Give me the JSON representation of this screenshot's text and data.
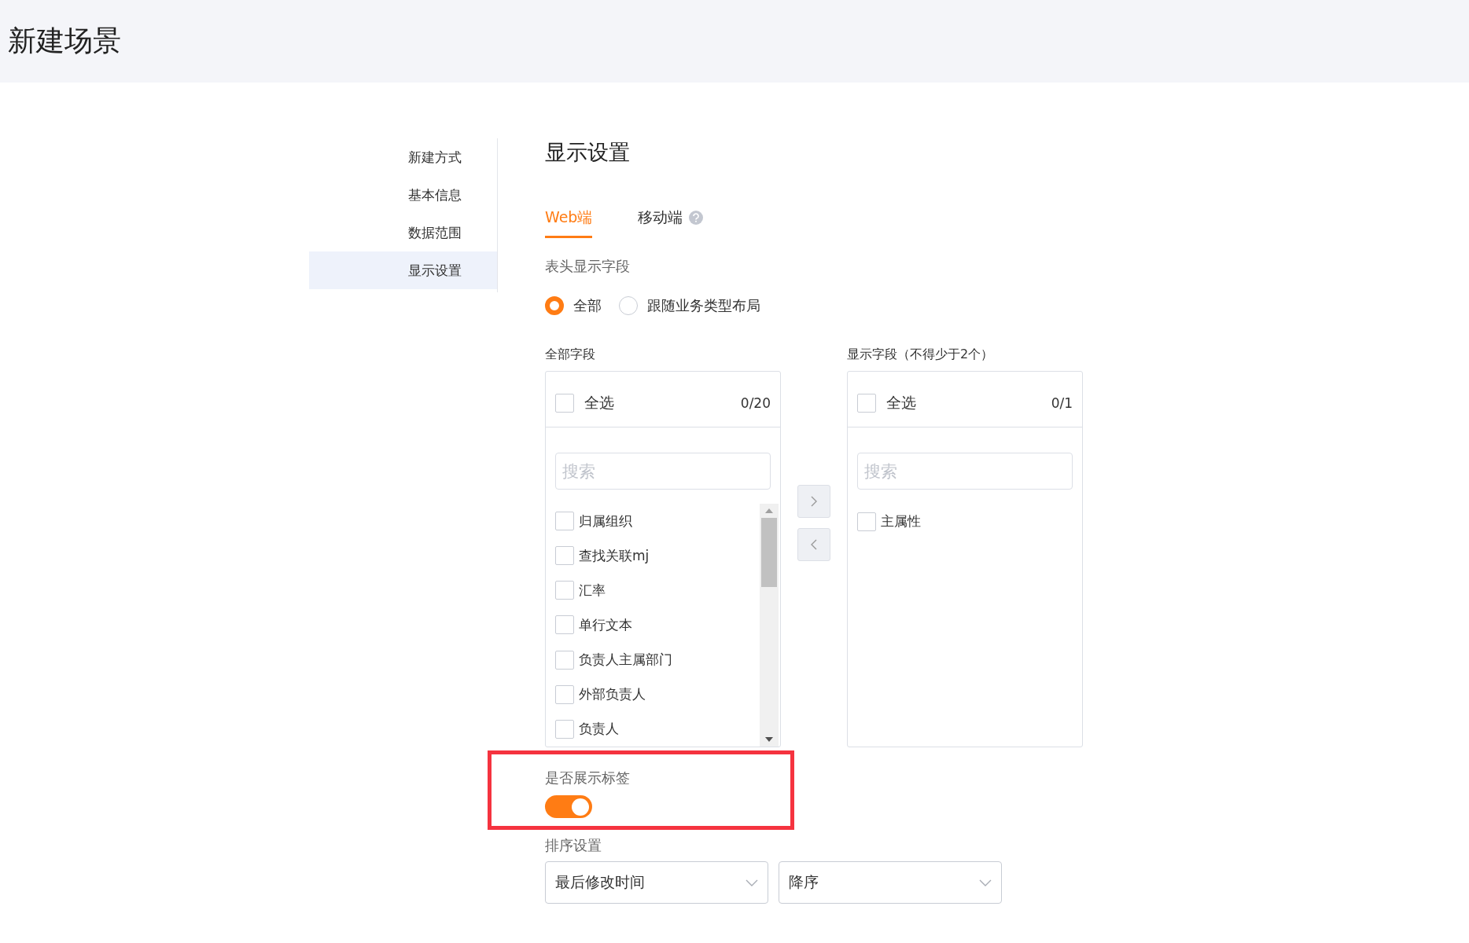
{
  "header": {
    "title": "新建场景"
  },
  "nav": {
    "items": [
      {
        "label": "新建方式",
        "selected": false
      },
      {
        "label": "基本信息",
        "selected": false
      },
      {
        "label": "数据范围",
        "selected": false
      },
      {
        "label": "显示设置",
        "selected": true
      }
    ]
  },
  "section": {
    "title": "显示设置",
    "tabs": [
      {
        "label": "Web端",
        "selected": true,
        "help": false
      },
      {
        "label": "移动端",
        "selected": false,
        "help": true
      }
    ],
    "header_fields": {
      "label": "表头显示字段",
      "options": [
        {
          "label": "全部",
          "selected": true
        },
        {
          "label": "跟随业务类型布局",
          "selected": false
        }
      ]
    },
    "transfer": {
      "panels": [
        {
          "label": "全部字段",
          "select_all": "全选",
          "select_all_checked": false,
          "count": "0/20",
          "placeholder": "搜索",
          "scrollbar": true,
          "items": [
            {
              "label": "归属组织",
              "checked": false
            },
            {
              "label": "查找关联mj",
              "checked": false
            },
            {
              "label": "汇率",
              "checked": false
            },
            {
              "label": "单行文本",
              "checked": false
            },
            {
              "label": "负责人主属部门",
              "checked": false
            },
            {
              "label": "外部负责人",
              "checked": false
            },
            {
              "label": "负责人",
              "checked": false
            }
          ]
        },
        {
          "label": "显示字段（不得少于2个）",
          "select_all": "全选",
          "select_all_checked": false,
          "count": "0/1",
          "placeholder": "搜索",
          "scrollbar": false,
          "items": [
            {
              "label": "主属性",
              "checked": false
            }
          ]
        }
      ],
      "buttons": [
        {
          "kind": "right",
          "disabled": true
        },
        {
          "kind": "left",
          "disabled": true
        }
      ]
    },
    "show_tags": {
      "label": "是否展示标签",
      "on": true,
      "highlighted": true
    },
    "sort": {
      "label": "排序设置",
      "selects": [
        {
          "value": "最后修改时间"
        },
        {
          "value": "降序"
        }
      ]
    }
  }
}
